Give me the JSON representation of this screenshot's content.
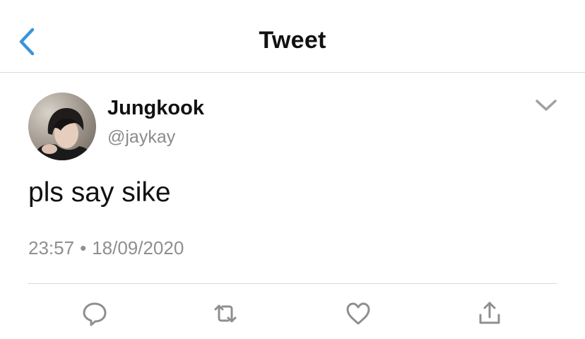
{
  "header": {
    "title": "Tweet",
    "back_icon": "chevron-left-icon",
    "accent_color": "#3b94d9"
  },
  "tweet": {
    "author": {
      "display_name": "Jungkook",
      "handle": "@jaykay",
      "avatar": "profile-photo"
    },
    "text": "pls say sike",
    "time": "23:57",
    "separator": "•",
    "date": "18/09/2020",
    "more_icon": "chevron-down-icon"
  },
  "actions": [
    {
      "name": "reply",
      "icon": "speech-bubble-icon"
    },
    {
      "name": "retweet",
      "icon": "retweet-icon"
    },
    {
      "name": "like",
      "icon": "heart-icon"
    },
    {
      "name": "share",
      "icon": "share-icon"
    }
  ],
  "colors": {
    "text": "#111111",
    "secondary_text": "#8b8b8b",
    "icon_gray": "#8f8f8f",
    "divider": "#d9d9d9"
  }
}
